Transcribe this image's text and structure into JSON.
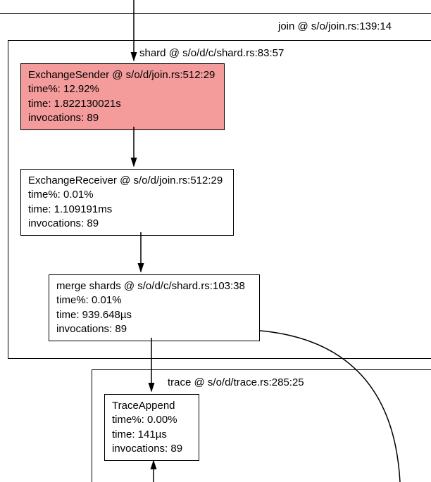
{
  "join": {
    "label": "join @ s/o/join.rs:139:14"
  },
  "shard": {
    "label": "shard @ s/o/d/c/shard.rs:83:57"
  },
  "nodes": {
    "sender": {
      "title": "ExchangeSender @ s/o/d/join.rs:512:29",
      "timepct": "time%: 12.92%",
      "time": "time: 1.822130021s",
      "inv": "invocations: 89"
    },
    "receiver": {
      "title": "ExchangeReceiver @ s/o/d/join.rs:512:29",
      "timepct": "time%: 0.01%",
      "time": "time: 1.109191ms",
      "inv": "invocations: 89"
    },
    "merge": {
      "title": "merge shards @ s/o/d/c/shard.rs:103:38",
      "timepct": "time%: 0.01%",
      "time": "time: 939.648µs",
      "inv": "invocations: 89"
    },
    "traceappend": {
      "title": "TraceAppend",
      "timepct": "time%: 0.00%",
      "time": "time: 141µs",
      "inv": "invocations: 89"
    }
  },
  "trace": {
    "label": "trace @ s/o/d/trace.rs:285:25"
  }
}
